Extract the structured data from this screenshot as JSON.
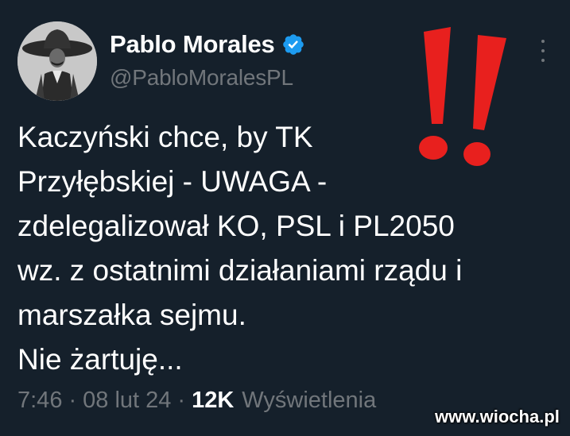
{
  "tweet": {
    "author_name": "Pablo Morales",
    "author_handle": "@PabloMoralesPL",
    "verified": true,
    "text_lines": [
      "Kaczyński chce, by TK",
      "Przyłębskiej - UWAGA -",
      "zdelegalizował KO, PSL i PL2050",
      "wz. z ostatnimi działaniami rządu i",
      "marszałka sejmu.",
      "Nie żartuję..."
    ],
    "time": "7:46",
    "date": "08 lut 24",
    "separator": "·",
    "views_count": "12K",
    "views_label": "Wyświetlenia"
  },
  "overlay": {
    "watermark": "www.wiocha.pl",
    "exclamation_color": "#e8201e"
  },
  "colors": {
    "background": "#15202b",
    "text": "#ffffff",
    "muted": "#71767b",
    "verified_blue": "#1d9bf0"
  },
  "icons": {
    "verified": "verified-badge-icon",
    "more": "more-options-icon",
    "exclamation": "double-exclamation-icon"
  }
}
